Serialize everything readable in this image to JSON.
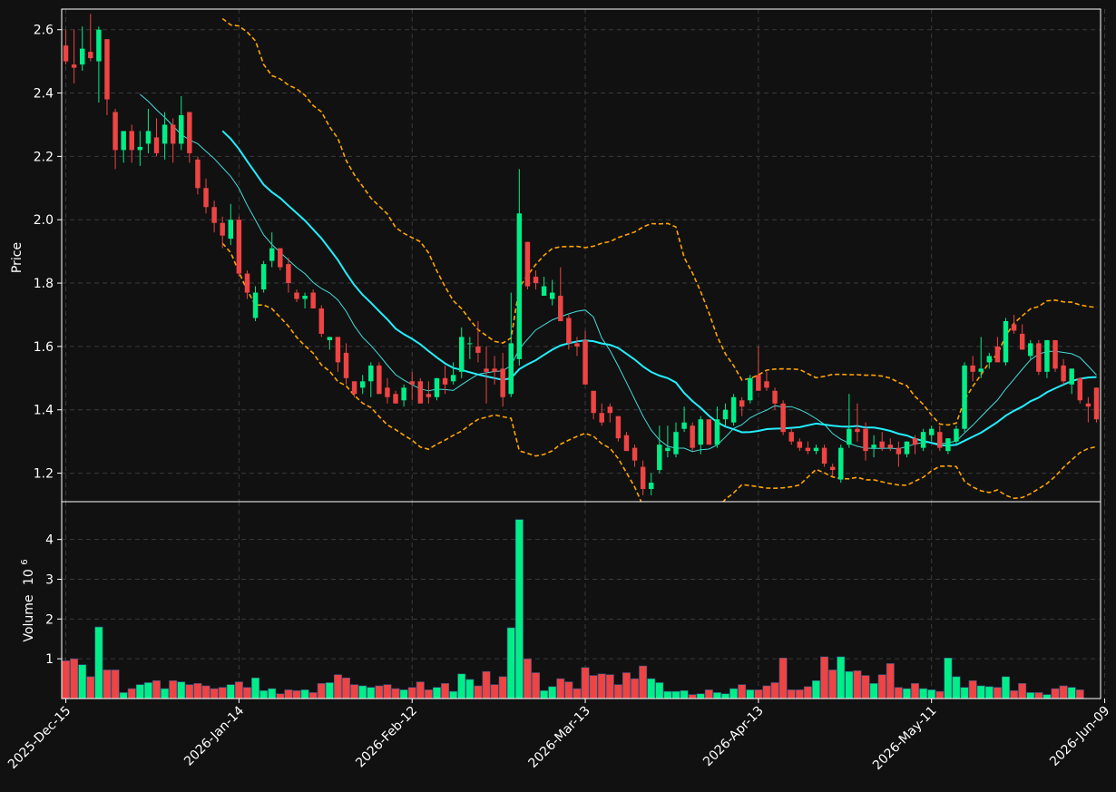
{
  "colors": {
    "background": "#111111",
    "up": "#00ee88",
    "down": "#ee4444",
    "sma_fast": "#44dddd",
    "sma_slow": "#22eeff",
    "bands": "#ffa500",
    "grid": "#3a3a3a",
    "axis_text": "#ffffff"
  },
  "chart_data": {
    "type": "candlestick",
    "panels": [
      "price",
      "volume"
    ],
    "ylabel_price": "Price",
    "ylabel_volume": "Volume",
    "volume_exponent_label": "10",
    "volume_exponent_power": "6",
    "ylim_price": [
      1.11,
      2.665
    ],
    "ylim_volume": [
      0,
      4.95
    ],
    "price_ticks": [
      "1.2",
      "1.4",
      "1.6",
      "1.8",
      "2.0",
      "2.2",
      "2.4",
      "2.6"
    ],
    "volume_ticks": [
      "1",
      "2",
      "3",
      "4"
    ],
    "x_tick_labels": [
      "2025-Dec-15",
      "2026-Jan-14",
      "2026-Feb-12",
      "2026-Mar-13",
      "2026-Apr-13",
      "2026-May-11",
      "2026-Jun-09"
    ],
    "x_tick_indices": [
      0,
      21,
      42,
      63,
      84,
      105,
      126
    ],
    "grid": true,
    "date_range": [
      "2025-12-15",
      "2026-06-10"
    ],
    "candles": [
      [
        2.55,
        2.6,
        2.49,
        2.5
      ],
      [
        2.49,
        2.6,
        2.43,
        2.48
      ],
      [
        2.49,
        2.61,
        2.47,
        2.54
      ],
      [
        2.53,
        2.65,
        2.5,
        2.51
      ],
      [
        2.5,
        2.61,
        2.37,
        2.6
      ],
      [
        2.57,
        2.57,
        2.33,
        2.38
      ],
      [
        2.34,
        2.35,
        2.16,
        2.22
      ],
      [
        2.22,
        2.28,
        2.18,
        2.28
      ],
      [
        2.28,
        2.3,
        2.18,
        2.22
      ],
      [
        2.22,
        2.28,
        2.17,
        2.23
      ],
      [
        2.24,
        2.35,
        2.21,
        2.28
      ],
      [
        2.26,
        2.32,
        2.2,
        2.21
      ],
      [
        2.24,
        2.34,
        2.19,
        2.3
      ],
      [
        2.3,
        2.32,
        2.18,
        2.24
      ],
      [
        2.24,
        2.39,
        2.22,
        2.33
      ],
      [
        2.34,
        2.34,
        2.18,
        2.21
      ],
      [
        2.19,
        2.2,
        2.08,
        2.1
      ],
      [
        2.1,
        2.13,
        2.02,
        2.04
      ],
      [
        2.04,
        2.06,
        1.96,
        1.99
      ],
      [
        1.99,
        2.01,
        1.91,
        1.95
      ],
      [
        1.94,
        2.05,
        1.92,
        2.0
      ],
      [
        2.0,
        2.01,
        1.82,
        1.83
      ],
      [
        1.83,
        1.84,
        1.75,
        1.77
      ],
      [
        1.69,
        1.79,
        1.68,
        1.77
      ],
      [
        1.78,
        1.87,
        1.77,
        1.86
      ],
      [
        1.87,
        1.96,
        1.85,
        1.91
      ],
      [
        1.91,
        1.91,
        1.84,
        1.85
      ],
      [
        1.86,
        1.88,
        1.77,
        1.8
      ],
      [
        1.77,
        1.78,
        1.74,
        1.75
      ],
      [
        1.75,
        1.77,
        1.72,
        1.76
      ],
      [
        1.77,
        1.78,
        1.72,
        1.72
      ],
      [
        1.72,
        1.73,
        1.63,
        1.64
      ],
      [
        1.62,
        1.63,
        1.59,
        1.63
      ],
      [
        1.63,
        1.63,
        1.52,
        1.55
      ],
      [
        1.58,
        1.61,
        1.48,
        1.5
      ],
      [
        1.49,
        1.49,
        1.44,
        1.45
      ],
      [
        1.47,
        1.51,
        1.45,
        1.49
      ],
      [
        1.49,
        1.55,
        1.44,
        1.54
      ],
      [
        1.54,
        1.55,
        1.45,
        1.45
      ],
      [
        1.47,
        1.5,
        1.42,
        1.44
      ],
      [
        1.45,
        1.46,
        1.42,
        1.42
      ],
      [
        1.43,
        1.48,
        1.41,
        1.47
      ],
      [
        1.49,
        1.52,
        1.43,
        1.48
      ],
      [
        1.49,
        1.5,
        1.43,
        1.42
      ],
      [
        1.45,
        1.49,
        1.42,
        1.44
      ],
      [
        1.44,
        1.5,
        1.43,
        1.5
      ],
      [
        1.5,
        1.54,
        1.45,
        1.48
      ],
      [
        1.49,
        1.55,
        1.48,
        1.51
      ],
      [
        1.52,
        1.66,
        1.5,
        1.63
      ],
      [
        1.61,
        1.63,
        1.56,
        1.61
      ],
      [
        1.6,
        1.68,
        1.55,
        1.58
      ],
      [
        1.53,
        1.6,
        1.42,
        1.52
      ],
      [
        1.53,
        1.57,
        1.48,
        1.52
      ],
      [
        1.53,
        1.58,
        1.41,
        1.44
      ],
      [
        1.45,
        1.77,
        1.44,
        1.61
      ],
      [
        1.56,
        2.16,
        1.54,
        2.02
      ],
      [
        1.93,
        1.93,
        1.78,
        1.79
      ],
      [
        1.82,
        1.84,
        1.78,
        1.8
      ],
      [
        1.76,
        1.82,
        1.76,
        1.79
      ],
      [
        1.75,
        1.81,
        1.73,
        1.77
      ],
      [
        1.76,
        1.85,
        1.68,
        1.68
      ],
      [
        1.69,
        1.7,
        1.59,
        1.61
      ],
      [
        1.61,
        1.63,
        1.57,
        1.6
      ],
      [
        1.62,
        1.65,
        1.48,
        1.48
      ],
      [
        1.46,
        1.46,
        1.37,
        1.39
      ],
      [
        1.39,
        1.42,
        1.35,
        1.36
      ],
      [
        1.41,
        1.42,
        1.36,
        1.39
      ],
      [
        1.38,
        1.38,
        1.3,
        1.31
      ],
      [
        1.32,
        1.33,
        1.27,
        1.27
      ],
      [
        1.28,
        1.29,
        1.22,
        1.24
      ],
      [
        1.22,
        1.24,
        1.13,
        1.15
      ],
      [
        1.15,
        1.2,
        1.13,
        1.17
      ],
      [
        1.21,
        1.35,
        1.2,
        1.29
      ],
      [
        1.27,
        1.35,
        1.25,
        1.28
      ],
      [
        1.26,
        1.36,
        1.25,
        1.33
      ],
      [
        1.34,
        1.41,
        1.33,
        1.36
      ],
      [
        1.35,
        1.36,
        1.27,
        1.28
      ],
      [
        1.29,
        1.38,
        1.26,
        1.37
      ],
      [
        1.37,
        1.37,
        1.29,
        1.29
      ],
      [
        1.29,
        1.41,
        1.28,
        1.37
      ],
      [
        1.37,
        1.42,
        1.35,
        1.4
      ],
      [
        1.36,
        1.45,
        1.35,
        1.44
      ],
      [
        1.43,
        1.44,
        1.38,
        1.41
      ],
      [
        1.43,
        1.51,
        1.42,
        1.5
      ],
      [
        1.51,
        1.6,
        1.48,
        1.46
      ],
      [
        1.49,
        1.52,
        1.46,
        1.47
      ],
      [
        1.46,
        1.47,
        1.4,
        1.42
      ],
      [
        1.42,
        1.43,
        1.32,
        1.33
      ],
      [
        1.33,
        1.34,
        1.29,
        1.3
      ],
      [
        1.3,
        1.31,
        1.27,
        1.28
      ],
      [
        1.28,
        1.3,
        1.26,
        1.27
      ],
      [
        1.27,
        1.29,
        1.26,
        1.28
      ],
      [
        1.28,
        1.29,
        1.22,
        1.23
      ],
      [
        1.22,
        1.23,
        1.19,
        1.21
      ],
      [
        1.18,
        1.29,
        1.17,
        1.28
      ],
      [
        1.29,
        1.45,
        1.28,
        1.34
      ],
      [
        1.34,
        1.42,
        1.3,
        1.33
      ],
      [
        1.34,
        1.36,
        1.24,
        1.27
      ],
      [
        1.28,
        1.32,
        1.25,
        1.29
      ],
      [
        1.3,
        1.33,
        1.27,
        1.28
      ],
      [
        1.29,
        1.31,
        1.27,
        1.28
      ],
      [
        1.28,
        1.3,
        1.22,
        1.26
      ],
      [
        1.26,
        1.3,
        1.25,
        1.3
      ],
      [
        1.31,
        1.32,
        1.26,
        1.29
      ],
      [
        1.28,
        1.34,
        1.27,
        1.33
      ],
      [
        1.32,
        1.35,
        1.3,
        1.34
      ],
      [
        1.33,
        1.35,
        1.27,
        1.28
      ],
      [
        1.27,
        1.31,
        1.26,
        1.31
      ],
      [
        1.3,
        1.35,
        1.29,
        1.34
      ],
      [
        1.34,
        1.55,
        1.33,
        1.54
      ],
      [
        1.54,
        1.57,
        1.49,
        1.52
      ],
      [
        1.52,
        1.63,
        1.5,
        1.53
      ],
      [
        1.55,
        1.58,
        1.53,
        1.57
      ],
      [
        1.6,
        1.63,
        1.55,
        1.55
      ],
      [
        1.55,
        1.69,
        1.54,
        1.68
      ],
      [
        1.67,
        1.7,
        1.64,
        1.65
      ],
      [
        1.64,
        1.67,
        1.59,
        1.59
      ],
      [
        1.57,
        1.62,
        1.56,
        1.61
      ],
      [
        1.61,
        1.62,
        1.51,
        1.52
      ],
      [
        1.52,
        1.62,
        1.5,
        1.62
      ],
      [
        1.62,
        1.62,
        1.52,
        1.53
      ],
      [
        1.54,
        1.56,
        1.48,
        1.49
      ],
      [
        1.48,
        1.53,
        1.45,
        1.53
      ],
      [
        1.5,
        1.5,
        1.42,
        1.43
      ],
      [
        1.42,
        1.44,
        1.36,
        1.41
      ],
      [
        1.47,
        1.47,
        1.36,
        1.37
      ]
    ],
    "volume": [
      0.95,
      1.0,
      0.85,
      0.55,
      1.8,
      0.72,
      0.72,
      0.15,
      0.25,
      0.35,
      0.4,
      0.45,
      0.25,
      0.45,
      0.42,
      0.35,
      0.38,
      0.32,
      0.25,
      0.28,
      0.35,
      0.42,
      0.28,
      0.52,
      0.2,
      0.25,
      0.12,
      0.22,
      0.2,
      0.22,
      0.15,
      0.38,
      0.4,
      0.6,
      0.52,
      0.35,
      0.32,
      0.28,
      0.32,
      0.35,
      0.25,
      0.22,
      0.28,
      0.42,
      0.22,
      0.28,
      0.38,
      0.18,
      0.62,
      0.48,
      0.32,
      0.68,
      0.35,
      0.55,
      1.78,
      4.5,
      1.0,
      0.65,
      0.2,
      0.3,
      0.5,
      0.42,
      0.25,
      0.78,
      0.58,
      0.62,
      0.6,
      0.35,
      0.65,
      0.5,
      0.82,
      0.5,
      0.4,
      0.18,
      0.18,
      0.2,
      0.1,
      0.12,
      0.22,
      0.15,
      0.12,
      0.25,
      0.35,
      0.22,
      0.22,
      0.32,
      0.4,
      1.02,
      0.22,
      0.22,
      0.3,
      0.45,
      1.05,
      0.72,
      1.05,
      0.68,
      0.7,
      0.58,
      0.38,
      0.6,
      0.88,
      0.28,
      0.25,
      0.38,
      0.25,
      0.22,
      0.18,
      1.02,
      0.55,
      0.28,
      0.45,
      0.32,
      0.3,
      0.28,
      0.55,
      0.2,
      0.38,
      0.15,
      0.15,
      0.1,
      0.25,
      0.32,
      0.28,
      0.22
    ],
    "series": [
      {
        "key": "sma_fast",
        "window": 10
      },
      {
        "key": "sma_slow",
        "window": 20
      },
      {
        "key": "bands",
        "window": 20,
        "stdev": 2
      }
    ]
  }
}
